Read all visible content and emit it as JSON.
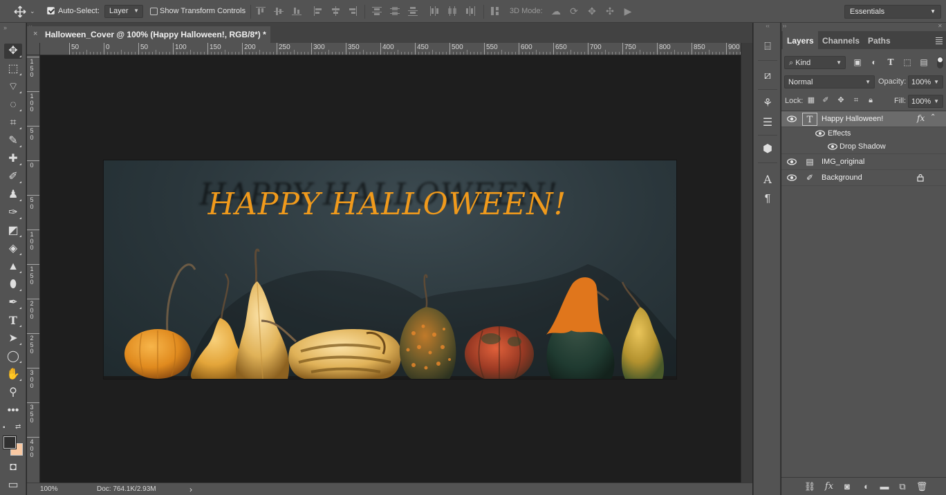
{
  "options_bar": {
    "auto_select_label": "Auto-Select:",
    "auto_select_checked": true,
    "auto_select_value": "Layer",
    "transform_controls_label": "Show Transform Controls",
    "transform_controls_checked": false,
    "mode_3d_label": "3D Mode:",
    "workspace": "Essentials"
  },
  "document": {
    "tab_title": "Halloween_Cover @ 100% (Happy Halloween!, RGB/8*) *",
    "close_glyph": "×"
  },
  "ruler": {
    "top_labels": [
      "50",
      "0",
      "50",
      "100",
      "150",
      "200",
      "250",
      "300",
      "350",
      "400",
      "450",
      "500",
      "550",
      "600",
      "650",
      "700",
      "750",
      "800",
      "850",
      "900"
    ],
    "left_labels": [
      "1 5 0",
      "1 0 0",
      "5 0",
      "0",
      "5 0",
      "1 0 0",
      "1 5 0",
      "2 0 0",
      "2 5 0",
      "3 0 0",
      "3 5 0",
      "4 0 0"
    ]
  },
  "canvas": {
    "headline": "HAPPY HALLOWEEN!",
    "headline_color": "#f09a1c"
  },
  "status": {
    "zoom": "100%",
    "doc_size": "Doc: 764.1K/2.93M",
    "arrow": "›"
  },
  "layers_panel": {
    "tabs": [
      "Layers",
      "Channels",
      "Paths"
    ],
    "active_tab": "Layers",
    "filter_kind": "Kind",
    "blend_mode": "Normal",
    "opacity_label": "Opacity:",
    "opacity_value": "100%",
    "lock_label": "Lock:",
    "fill_label": "Fill:",
    "fill_value": "100%",
    "layers": [
      {
        "name": "Happy Halloween!",
        "type": "text",
        "selected": true,
        "visible": true,
        "has_fx": true
      },
      {
        "name": "IMG_original",
        "type": "smart-object",
        "selected": false,
        "visible": true
      },
      {
        "name": "Background",
        "type": "pixel",
        "selected": false,
        "visible": true,
        "locked": true
      }
    ],
    "effects_label": "Effects",
    "effect_items": [
      "Drop Shadow"
    ],
    "fx_glyph": "fx"
  },
  "colors": {
    "foreground": "#303030",
    "background": "#f9c9a3",
    "canvas_bg": "#1e1e1e",
    "ui_panel": "#535353"
  }
}
